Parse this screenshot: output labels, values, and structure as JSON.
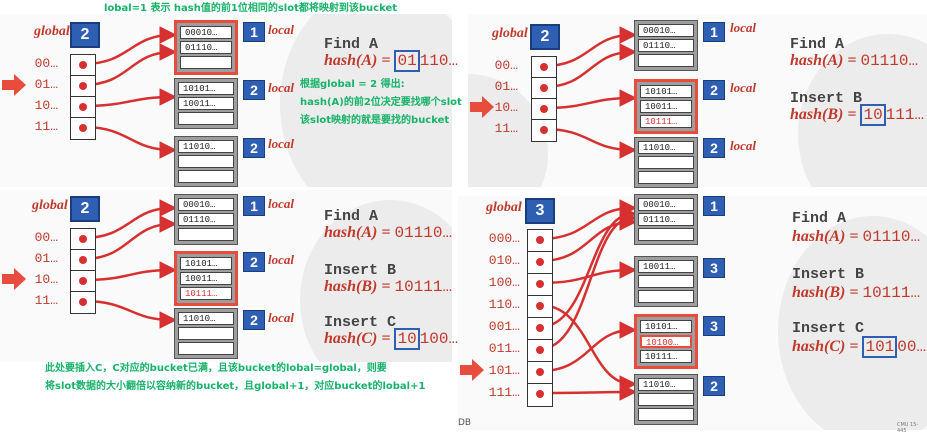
{
  "notes": {
    "top": "lobal=1 表示 hash值的前1位相同的slot都将映射到该bucket",
    "mid_line1": "根据global = 2 得出:",
    "mid_line2": "hash(A)的前2位决定要找哪个slot",
    "mid_line3": "该slot映射的就是要找的bucket",
    "bot_line1": "此处要插入C，C对应的bucket已满，且该bucket的lobal=global，则要",
    "bot_line2": "将slot数据的大小翻倍以容纳新的bucket，且global+1，对应bucket的lobal+1"
  },
  "labels": {
    "global": "global",
    "local": "local"
  },
  "colors": {
    "accent": "#d63031",
    "blue": "#2f5fb3",
    "note": "#17b26a"
  },
  "panel1": {
    "global": "2",
    "idx": [
      "00…",
      "01…",
      "10…",
      "11…"
    ],
    "buckets": [
      {
        "local": "1",
        "slots": [
          "00010…",
          "01110…",
          ""
        ]
      },
      {
        "local": "2",
        "slots": [
          "10101…",
          "10011…",
          ""
        ]
      },
      {
        "local": "2",
        "slots": [
          "11010…",
          "",
          ""
        ]
      }
    ],
    "op1": "Find A",
    "hash1_fn": "hash(A) =",
    "hash1_box": "01",
    "hash1_rest": "110…"
  },
  "panel2": {
    "global": "2",
    "idx": [
      "00…",
      "01…",
      "10…",
      "11…"
    ],
    "buckets": [
      {
        "local": "1",
        "slots": [
          "00010…",
          "01110…",
          ""
        ]
      },
      {
        "local": "2",
        "slots": [
          "10101…",
          "10011…",
          "10111…"
        ]
      },
      {
        "local": "2",
        "slots": [
          "11010…",
          "",
          ""
        ]
      }
    ],
    "op1": "Find A",
    "hash1_fn": "hash(A) =",
    "hash1_val": "01110…",
    "op2": "Insert B",
    "hash2_fn": "hash(B) =",
    "hash2_box": "10",
    "hash2_rest": "111…"
  },
  "panel3": {
    "global": "2",
    "idx": [
      "00…",
      "01…",
      "10…",
      "11…"
    ],
    "buckets": [
      {
        "local": "1",
        "slots": [
          "00010…",
          "01110…",
          ""
        ]
      },
      {
        "local": "2",
        "slots": [
          "10101…",
          "10011…",
          "10111…"
        ]
      },
      {
        "local": "2",
        "slots": [
          "11010…",
          "",
          ""
        ]
      }
    ],
    "op1": "Find A",
    "hash1_fn": "hash(A) =",
    "hash1_val": "01110…",
    "op2": "Insert B",
    "hash2_fn": "hash(B) =",
    "hash2_val": "10111…",
    "op3": "Insert C",
    "hash3_fn": "hash(C) =",
    "hash3_box": "10",
    "hash3_rest": "100…"
  },
  "panel4": {
    "global": "3",
    "idx": [
      "000…",
      "010…",
      "100…",
      "110…",
      "001…",
      "011…",
      "101…",
      "111…"
    ],
    "buckets": [
      {
        "local": "1",
        "slots": [
          "00010…",
          "01110…",
          ""
        ]
      },
      {
        "local": "3",
        "slots": [
          "10011…",
          "",
          ""
        ]
      },
      {
        "local": "3",
        "slots": [
          "10101…",
          "10100…",
          "10111…"
        ]
      },
      {
        "local": "2",
        "slots": [
          "11010…",
          "",
          ""
        ]
      }
    ],
    "op1": "Find A",
    "hash1_fn": "hash(A) =",
    "hash1_val": "01110…",
    "op2": "Insert B",
    "hash2_fn": "hash(B) =",
    "hash2_val": "10111…",
    "op3": "Insert C",
    "hash3_fn": "hash(C) =",
    "hash3_box": "101",
    "hash3_rest": "00…"
  },
  "footer": {
    "left": "DB",
    "right": "CMU 15-445"
  }
}
